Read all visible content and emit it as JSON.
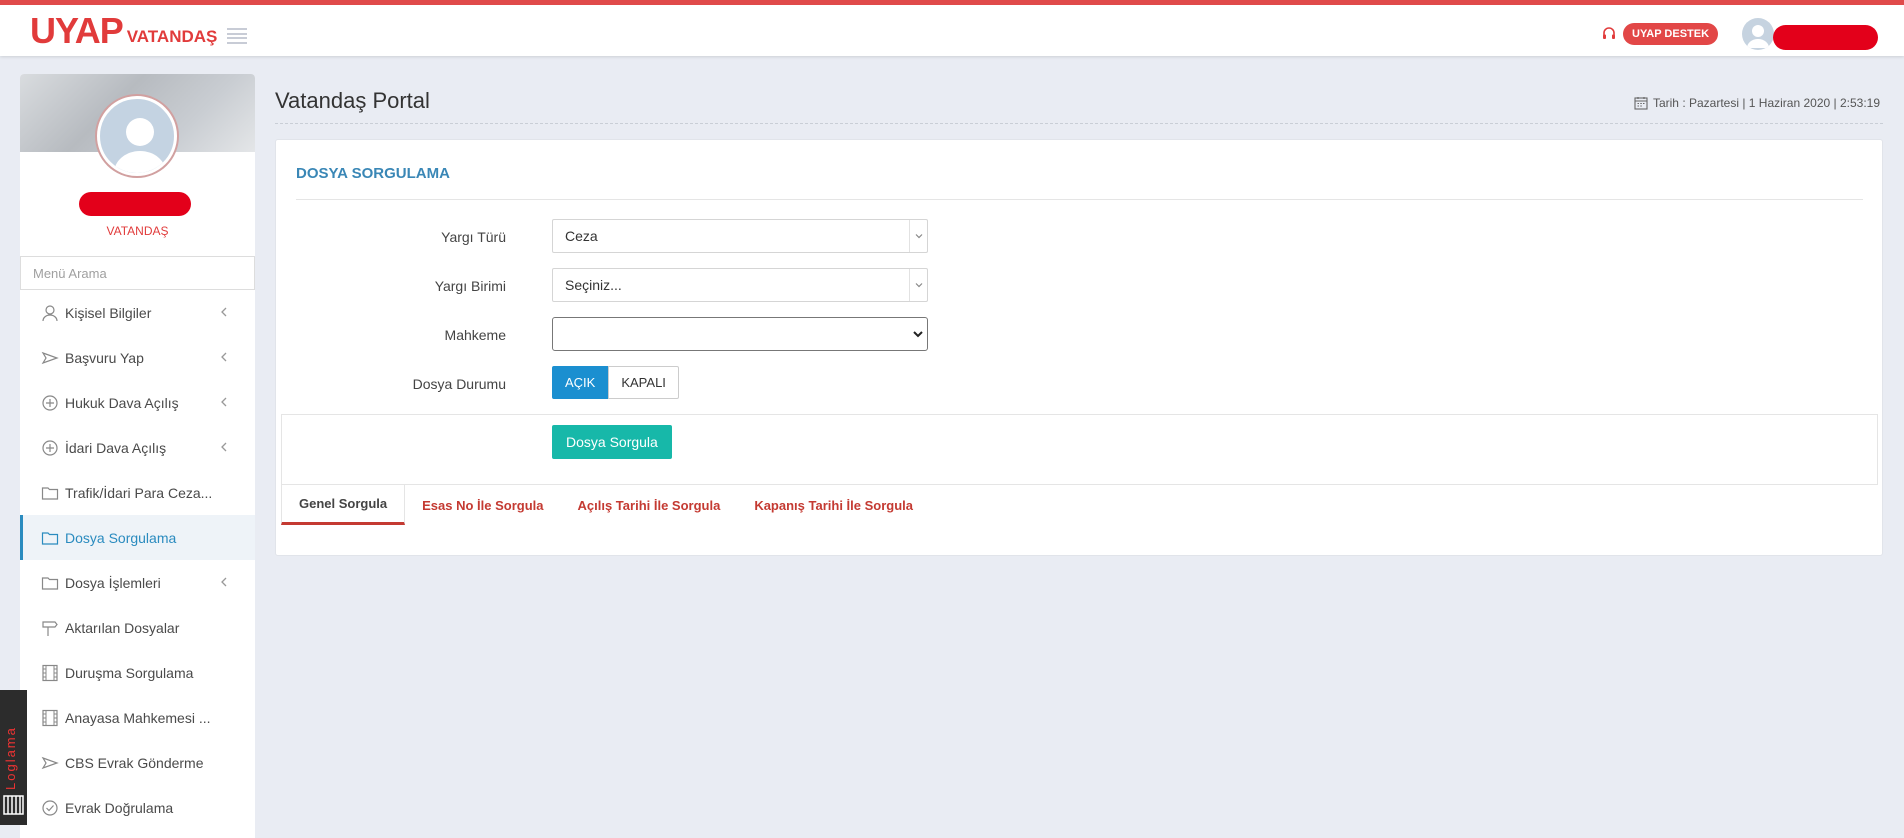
{
  "header": {
    "logo_main": "UYAP",
    "logo_sub": "VATANDAŞ",
    "support_label": "UYAP DESTEK"
  },
  "sidebar": {
    "role": "VATANDAŞ",
    "search_placeholder": "Menü Arama",
    "items": [
      {
        "label": "Kişisel Bilgiler",
        "icon": "user-icon",
        "expandable": true
      },
      {
        "label": "Başvuru Yap",
        "icon": "send-icon",
        "expandable": true
      },
      {
        "label": "Hukuk Dava Açılış",
        "icon": "plus-circle-icon",
        "expandable": true
      },
      {
        "label": "İdari Dava Açılış",
        "icon": "plus-circle-icon",
        "expandable": true
      },
      {
        "label": "Trafik/İdari Para Ceza...",
        "icon": "folder-icon",
        "expandable": false
      },
      {
        "label": "Dosya Sorgulama",
        "icon": "folder-icon",
        "expandable": false,
        "active": true
      },
      {
        "label": "Dosya İşlemleri",
        "icon": "folder-icon",
        "expandable": true
      },
      {
        "label": "Aktarılan Dosyalar",
        "icon": "signpost-icon",
        "expandable": false
      },
      {
        "label": "Duruşma Sorgulama",
        "icon": "film-icon",
        "expandable": false
      },
      {
        "label": "Anayasa Mahkemesi ...",
        "icon": "film-icon",
        "expandable": false
      },
      {
        "label": "CBS Evrak Gönderme",
        "icon": "send-icon",
        "expandable": false
      },
      {
        "label": "Evrak Doğrulama",
        "icon": "check-circle-icon",
        "expandable": false
      }
    ],
    "loglama_label": "Loglama"
  },
  "main": {
    "page_title": "Vatandaş Portal",
    "date_text": "Tarih : Pazartesi | 1 Haziran 2020 | 2:53:19",
    "panel_title": "DOSYA SORGULAMA",
    "form": {
      "yargi_turu_label": "Yargı Türü",
      "yargi_turu_value": "Ceza",
      "yargi_birimi_label": "Yargı Birimi",
      "yargi_birimi_value": "Seçiniz...",
      "mahkeme_label": "Mahkeme",
      "mahkeme_value": "",
      "dosya_durumu_label": "Dosya Durumu",
      "acik_label": "AÇIK",
      "kapali_label": "KAPALI",
      "query_button": "Dosya Sorgula"
    },
    "tabs": [
      {
        "label": "Genel Sorgula",
        "active": true
      },
      {
        "label": "Esas No İle Sorgula",
        "active": false
      },
      {
        "label": "Açılış Tarihi İle Sorgula",
        "active": false
      },
      {
        "label": "Kapanış Tarihi İle Sorgula",
        "active": false
      }
    ]
  },
  "colors": {
    "brand_red": "#e13b3b",
    "accent_blue": "#2a8bbf",
    "toggle_blue": "#1b8fd0",
    "button_teal": "#17b8a9"
  }
}
